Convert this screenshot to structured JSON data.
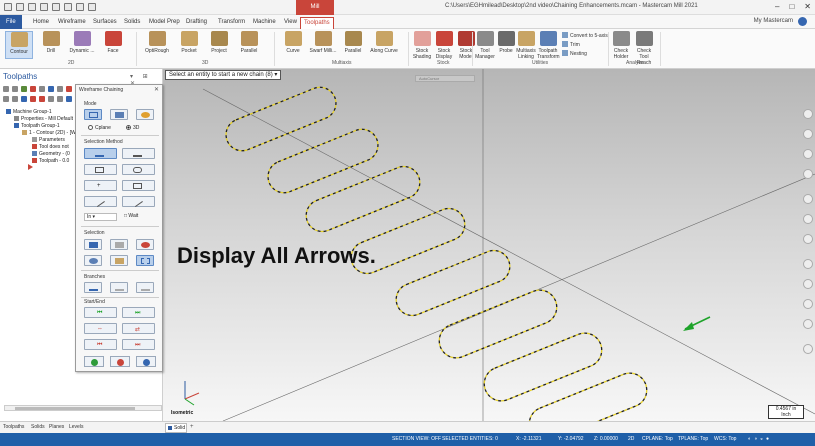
{
  "app": {
    "context_tab": "Mill",
    "window_title": "C:\\Users\\EGHmilead\\Desktop\\2nd video\\Chaining Enhancements.mcam - Mastercam Mill 2021",
    "my_mastercam": "My Mastercam"
  },
  "ribbon_tabs": [
    "File",
    "Home",
    "Wireframe",
    "Surfaces",
    "Solids",
    "Model Prep",
    "Drafting",
    "Transform",
    "Machine",
    "View",
    "Toolpaths"
  ],
  "ribbon": {
    "groups": [
      {
        "label": "2D",
        "buttons": [
          "Contour",
          "Drill",
          "Dynamic ...",
          "Face"
        ]
      },
      {
        "label": "3D",
        "buttons": [
          "OptiRough",
          "Pocket",
          "Project",
          "Parallel"
        ]
      },
      {
        "label": "Multiaxis",
        "buttons": [
          "Curve",
          "Swarf Milli...",
          "Parallel",
          "Along Curve"
        ]
      },
      {
        "label": "Stock",
        "buttons": [
          "Stock Shading",
          "Stock Display",
          "Stock Model"
        ]
      },
      {
        "label": "Utilities",
        "buttons": [
          "Tool Manager",
          "Probe",
          "Multiaxis Linking",
          "Toolpath Transform"
        ]
      },
      {
        "label": "Analyze",
        "buttons": [
          "Check Holder",
          "Check Tool Reach"
        ]
      }
    ],
    "utility_small": [
      "Convert to 5-axis",
      "Trim",
      "Nesting"
    ]
  },
  "left_panel": {
    "title": "Toolpaths",
    "tree": [
      "Machine Group-1",
      "Properties - Mill Default",
      "Toolpath Group-1",
      "1 - Contour (2D) - [WC",
      "Parameters",
      "Tool does not",
      "Geometry - (0",
      "Toolpath - 0.0"
    ]
  },
  "dialog": {
    "title": "Wireframe Chaining",
    "sections": {
      "mode": "Mode",
      "selection_method": "Selection Method",
      "selection": "Selection",
      "branches": "Branches",
      "start_end": "Start/End"
    },
    "mode_options": [
      "Cplane",
      "3D"
    ],
    "mode_selected": "3D",
    "in_value": "In",
    "wait_label": "Wait"
  },
  "viewport": {
    "prompt": "Select an entity to start a new chain (8)",
    "autocursor": "AutoCursor",
    "caption": "Display All Arrows.",
    "view_label": "Isometric",
    "scale_value": "0.4567 in",
    "scale_unit": "Inch"
  },
  "bottom_tabs": [
    "Toolpaths",
    "Solids",
    "Planes",
    "Levels"
  ],
  "viewport_tab": "Solid",
  "status_bar": {
    "section_view": "SECTION VIEW: OFF",
    "selected": "SELECTED ENTITIES: 0",
    "x": "X: -2.11321",
    "y": "Y: -2.04792",
    "z": "Z: 0.00000",
    "mode": "2D",
    "cplane": "CPLANE: Top",
    "tplane": "TPLANE: Top",
    "wcs": "WCS: Top"
  },
  "colors": {
    "file_tab": "#2c5aa0",
    "context_tab": "#c9453a",
    "status_bar": "#1f5fa8",
    "chain_dash": "#e6d02a",
    "arrow": "#1ea32a"
  }
}
